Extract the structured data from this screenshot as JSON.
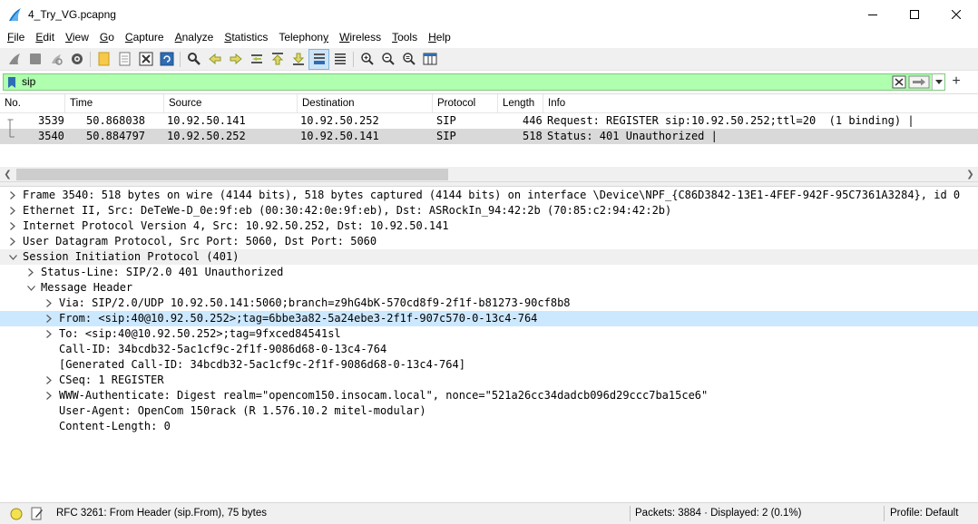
{
  "window": {
    "title": "4_Try_VG.pcapng",
    "minimize_icon": "minimize-icon",
    "maximize_icon": "maximize-icon",
    "close_icon": "close-icon"
  },
  "menu": [
    {
      "label": "File",
      "u": "F",
      "rest": "ile"
    },
    {
      "label": "Edit",
      "u": "E",
      "rest": "dit"
    },
    {
      "label": "View",
      "u": "V",
      "rest": "iew"
    },
    {
      "label": "Go",
      "u": "G",
      "rest": "o"
    },
    {
      "label": "Capture",
      "u": "C",
      "rest": "apture"
    },
    {
      "label": "Analyze",
      "u": "A",
      "rest": "nalyze"
    },
    {
      "label": "Statistics",
      "u": "S",
      "rest": "tatistics"
    },
    {
      "label": "Telephony",
      "pre": "Telephon",
      "u": "y",
      "rest": ""
    },
    {
      "label": "Wireless",
      "u": "W",
      "rest": "ireless"
    },
    {
      "label": "Tools",
      "u": "T",
      "rest": "ools"
    },
    {
      "label": "Help",
      "u": "H",
      "rest": "elp"
    }
  ],
  "filter": {
    "value": "sip"
  },
  "packet_list": {
    "columns": [
      "No.",
      "Time",
      "Source",
      "Destination",
      "Protocol",
      "Length",
      "Info"
    ],
    "rows": [
      {
        "no": "3539",
        "time": "50.868038",
        "source": "10.92.50.141",
        "destination": "10.92.50.252",
        "protocol": "SIP",
        "length": "446",
        "info": "Request: REGISTER sip:10.92.50.252;ttl=20  (1 binding) |"
      },
      {
        "no": "3540",
        "time": "50.884797",
        "source": "10.92.50.252",
        "destination": "10.92.50.141",
        "protocol": "SIP",
        "length": "518",
        "info": "Status: 401 Unauthorized |"
      }
    ],
    "selected_row": 1
  },
  "details": [
    {
      "indent": 0,
      "expander": "right",
      "text": "Frame 3540: 518 bytes on wire (4144 bits), 518 bytes captured (4144 bits) on interface \\Device\\NPF_{C86D3842-13E1-4FEF-942F-95C7361A3284}, id 0"
    },
    {
      "indent": 0,
      "expander": "right",
      "text": "Ethernet II, Src: DeTeWe-D_0e:9f:eb (00:30:42:0e:9f:eb), Dst: ASRockIn_94:42:2b (70:85:c2:94:42:2b)"
    },
    {
      "indent": 0,
      "expander": "right",
      "text": "Internet Protocol Version 4, Src: 10.92.50.252, Dst: 10.92.50.141"
    },
    {
      "indent": 0,
      "expander": "right",
      "text": "User Datagram Protocol, Src Port: 5060, Dst Port: 5060"
    },
    {
      "indent": 0,
      "expander": "down",
      "text": "Session Initiation Protocol (401)",
      "alt": true
    },
    {
      "indent": 1,
      "expander": "right",
      "text": "Status-Line: SIP/2.0 401 Unauthorized"
    },
    {
      "indent": 1,
      "expander": "down",
      "text": "Message Header"
    },
    {
      "indent": 2,
      "expander": "right",
      "text": "Via: SIP/2.0/UDP 10.92.50.141:5060;branch=z9hG4bK-570cd8f9-2f1f-b81273-90cf8b8"
    },
    {
      "indent": 2,
      "expander": "right",
      "text": "From: <sip:40@10.92.50.252>;tag=6bbe3a82-5a24ebe3-2f1f-907c570-0-13c4-764",
      "selected": true
    },
    {
      "indent": 2,
      "expander": "right",
      "text": "To: <sip:40@10.92.50.252>;tag=9fxced84541sl"
    },
    {
      "indent": 2,
      "expander": "none",
      "text": "Call-ID: 34bcdb32-5ac1cf9c-2f1f-9086d68-0-13c4-764"
    },
    {
      "indent": 2,
      "expander": "none",
      "text": "[Generated Call-ID: 34bcdb32-5ac1cf9c-2f1f-9086d68-0-13c4-764]"
    },
    {
      "indent": 2,
      "expander": "right",
      "text": "CSeq: 1 REGISTER"
    },
    {
      "indent": 2,
      "expander": "right",
      "text": "WWW-Authenticate: Digest realm=\"opencom150.insocam.local\", nonce=\"521a26cc34dadcb096d29ccc7ba15ce6\""
    },
    {
      "indent": 2,
      "expander": "none",
      "text": "User-Agent: OpenCom 150rack (R 1.576.10.2 mitel-modular)"
    },
    {
      "indent": 2,
      "expander": "none",
      "text": "Content-Length: 0"
    }
  ],
  "status": {
    "field_info": "RFC 3261: From Header (sip.From), 75 bytes",
    "packets": "Packets: 3884 · Displayed: 2 (0.1%)",
    "profile": "Profile: Default"
  },
  "colors": {
    "filter_valid": "#afffaf",
    "selected_detail": "#cce8ff",
    "selected_packet": "#d9d9d9"
  }
}
